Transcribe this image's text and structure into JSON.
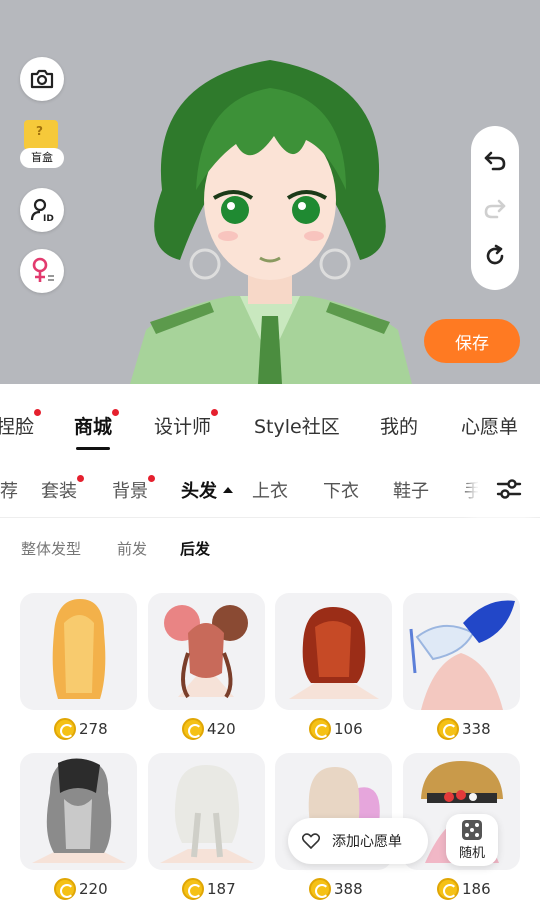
{
  "stage": {
    "blind_box_label": "盲盒"
  },
  "actions": {
    "save_label": "保存"
  },
  "main_tabs": [
    {
      "label": "捏脸",
      "dot": true
    },
    {
      "label": "商城",
      "dot": true,
      "active": true
    },
    {
      "label": "设计师",
      "dot": true
    },
    {
      "label": "Style社区",
      "dot": false
    },
    {
      "label": "我的",
      "dot": false
    },
    {
      "label": "心愿单",
      "dot": false
    }
  ],
  "category_tabs": [
    {
      "label": "推荐",
      "dot": false
    },
    {
      "label": "套装",
      "dot": true
    },
    {
      "label": "背景",
      "dot": true
    },
    {
      "label": "头发",
      "dot": false,
      "active": true
    },
    {
      "label": "上衣",
      "dot": false
    },
    {
      "label": "下衣",
      "dot": false
    },
    {
      "label": "鞋子",
      "dot": false
    },
    {
      "label": "手",
      "dot": false
    }
  ],
  "sub_tabs": [
    {
      "label": "整体发型"
    },
    {
      "label": "前发"
    },
    {
      "label": "后发",
      "active": true
    }
  ],
  "items": [
    {
      "price": "278"
    },
    {
      "price": "420"
    },
    {
      "price": "106"
    },
    {
      "price": "338"
    },
    {
      "price": "220"
    },
    {
      "price": "187"
    },
    {
      "price": "388"
    },
    {
      "price": "186"
    }
  ],
  "floating": {
    "wishlist_label": "添加心愿单",
    "random_label": "随机"
  }
}
